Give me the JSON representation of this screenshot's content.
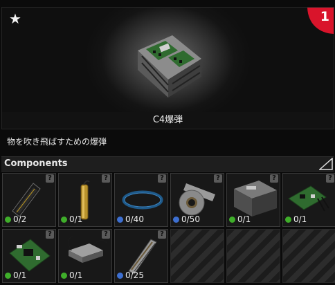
{
  "item": {
    "name": "C4爆弾",
    "description": "物を吹き飛ばすための爆弾",
    "badge_number": "1",
    "favorite_icon": "star-icon",
    "badge_color": "#d9142b"
  },
  "components": {
    "title": "Components",
    "items": [
      {
        "icon": "ram-stick-icon",
        "count": "0/2",
        "status": "green"
      },
      {
        "icon": "brass-cylinder-icon",
        "count": "0/1",
        "status": "green"
      },
      {
        "icon": "blue-cable-icon",
        "count": "0/40",
        "status": "blue"
      },
      {
        "icon": "duct-tape-icon",
        "count": "0/50",
        "status": "blue"
      },
      {
        "icon": "metal-casing-icon",
        "count": "0/1",
        "status": "green"
      },
      {
        "icon": "circuit-board-icon",
        "count": "0/1",
        "status": "green"
      },
      {
        "icon": "motherboard-icon",
        "count": "0/1",
        "status": "green"
      },
      {
        "icon": "detonator-box-icon",
        "count": "0/1",
        "status": "green"
      },
      {
        "icon": "wire-bundle-icon",
        "count": "0/25",
        "status": "blue"
      }
    ],
    "empty_slots": 3,
    "unknown_marker": "?"
  }
}
